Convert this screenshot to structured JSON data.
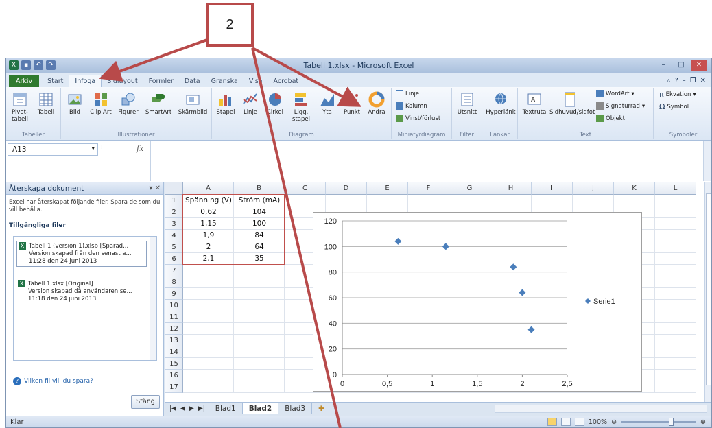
{
  "annotation": {
    "number": "2"
  },
  "window": {
    "title": "Tabell 1.xlsx - Microsoft Excel"
  },
  "tabs": [
    "Arkiv",
    "Start",
    "Infoga",
    "Sidlayout",
    "Formler",
    "Data",
    "Granska",
    "Visa",
    "Acrobat"
  ],
  "active_tab": "Infoga",
  "ribbon": {
    "groups": {
      "tabeller": "Tabeller",
      "illustrationer": "Illustrationer",
      "diagram": "Diagram",
      "miniatyr": "Miniatyrdiagram",
      "filter": "Filter",
      "lankar": "Länkar",
      "text": "Text",
      "symboler": "Symboler"
    },
    "buttons": {
      "pivot": "Pivot-tabell",
      "tabell": "Tabell",
      "bild": "Bild",
      "clipart": "Clip Art",
      "figurer": "Figurer",
      "smartart": "SmartArt",
      "skarmbild": "Skärmbild",
      "stapel": "Stapel",
      "linje": "Linje",
      "cirkel": "Cirkel",
      "ligg": "Ligg. stapel",
      "yta": "Yta",
      "punkt": "Punkt",
      "andra": "Andra",
      "mini_linje": "Linje",
      "mini_kolumn": "Kolumn",
      "mini_vinst": "Vinst/förlust",
      "utsnitt": "Utsnitt",
      "hyperlank": "Hyperlänk",
      "textruta": "Textruta",
      "sidhuvud": "Sidhuvud/sidfot",
      "wordart": "WordArt",
      "signatur": "Signaturrad",
      "objekt": "Objekt",
      "ekvation": "Ekvation",
      "symbol": "Symbol"
    }
  },
  "formula_bar": {
    "name_box": "A13",
    "fx": "fx",
    "value": ""
  },
  "recovery_pane": {
    "title": "Återskapa dokument",
    "description": "Excel har återskapat följande filer. Spara de som du vill behålla.",
    "heading": "Tillgängliga filer",
    "files": [
      {
        "name": "Tabell 1 (version 1).xlsb  [Sparad...",
        "line2": "Version skapad från den senast a...",
        "line3": "11:28 den 24 juni 2013"
      },
      {
        "name": "Tabell 1.xlsx  [Original]",
        "line2": "Version skapad då användaren se...",
        "line3": "11:18 den 24 juni 2013"
      }
    ],
    "help_link": "Vilken fil vill du spara?",
    "close_button": "Stäng"
  },
  "sheet": {
    "columns": [
      "A",
      "B",
      "C",
      "D",
      "E",
      "F",
      "G",
      "H",
      "I",
      "J",
      "K",
      "L"
    ],
    "rows": [
      "1",
      "2",
      "3",
      "4",
      "5",
      "6",
      "7",
      "8",
      "9",
      "10",
      "11",
      "12",
      "13",
      "14",
      "15",
      "16",
      "17"
    ],
    "headers": [
      "Spänning (V)",
      "Ström (mA)"
    ],
    "data": [
      [
        "0,62",
        "104"
      ],
      [
        "1,15",
        "100"
      ],
      [
        "1,9",
        "84"
      ],
      [
        "2",
        "64"
      ],
      [
        "2,1",
        "35"
      ]
    ]
  },
  "chart_data": {
    "type": "scatter",
    "x_tick_labels": [
      "0",
      "0,5",
      "1",
      "1,5",
      "2",
      "2,5"
    ],
    "y_tick_labels": [
      "0",
      "20",
      "40",
      "60",
      "80",
      "100",
      "120"
    ],
    "xlim": [
      0,
      2.5
    ],
    "ylim": [
      0,
      120
    ],
    "grid": "horizontal",
    "legend_position": "right",
    "color": "#4a7ebb",
    "series": [
      {
        "name": "Serie1",
        "x": [
          0.62,
          1.15,
          1.9,
          2,
          2.1
        ],
        "y": [
          104,
          100,
          84,
          64,
          35
        ]
      }
    ]
  },
  "sheet_tabs": [
    "Blad1",
    "Blad2",
    "Blad3"
  ],
  "active_sheet": "Blad2",
  "status": {
    "state": "Klar",
    "zoom": "100%"
  },
  "colors": {
    "arrow": "#b84a4a",
    "file_tab": "#2f7a2f",
    "table_border": "#c0504d"
  }
}
